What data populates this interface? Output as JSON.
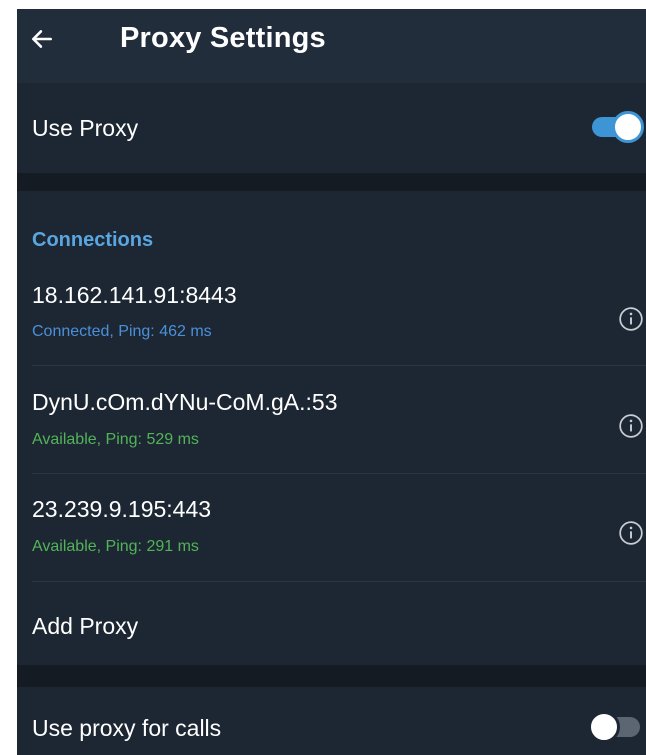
{
  "header": {
    "title": "Proxy Settings",
    "back_icon": "arrow-left-icon"
  },
  "use_proxy": {
    "label": "Use Proxy",
    "enabled": true
  },
  "connections": {
    "section_title": "Connections",
    "items": [
      {
        "address": "18.162.141.91:8443",
        "status": "Connected, Ping: 462 ms",
        "status_color": "#4a90d9",
        "info_icon": "info-icon"
      },
      {
        "address": "DynU.cOm.dYNu-CoM.gA.:53",
        "status": "Available, Ping: 529 ms",
        "status_color": "#52b358",
        "info_icon": "info-icon"
      },
      {
        "address": "23.239.9.195:443",
        "status": "Available, Ping: 291 ms",
        "status_color": "#52b358",
        "info_icon": "info-icon"
      }
    ],
    "add_label": "Add Proxy"
  },
  "calls": {
    "label": "Use proxy for calls",
    "enabled": false
  },
  "colors": {
    "background": "#1d2733",
    "appbar": "#212d3b",
    "accent": "#3d95d6",
    "connected": "#4a90d9",
    "available": "#52b358"
  }
}
